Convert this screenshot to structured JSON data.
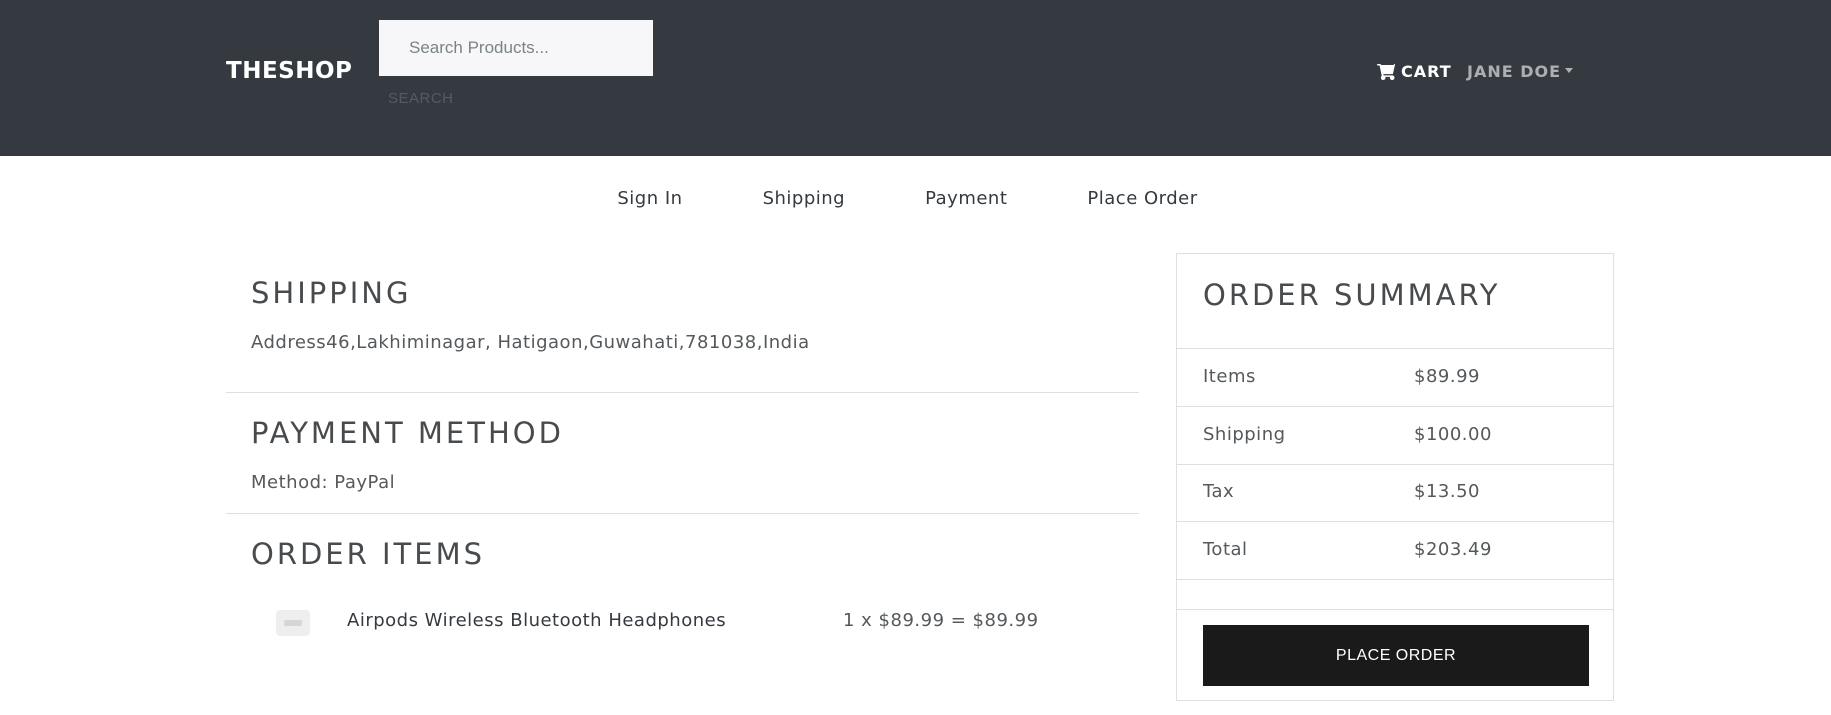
{
  "header": {
    "brand": "THESHOP",
    "search_placeholder": "Search Products...",
    "search_button": "SEARCH",
    "cart_label": "CART",
    "user_label": "JANE DOE",
    "background_color": "#343a40"
  },
  "steps": [
    "Sign In",
    "Shipping",
    "Payment",
    "Place Order"
  ],
  "shipping": {
    "title": "SHIPPING",
    "address": "Address46,Lakhiminagar, Hatigaon,Guwahati,781038,India"
  },
  "payment": {
    "title": "PAYMENT METHOD",
    "method": "Method: PayPal"
  },
  "order_items": {
    "title": "ORDER ITEMS",
    "items": [
      {
        "name": "Airpods Wireless Bluetooth Headphones",
        "price_line": "1 x $89.99 = $89.99"
      }
    ]
  },
  "summary": {
    "title": "ORDER SUMMARY",
    "rows": [
      {
        "label": "Items",
        "value": "$89.99"
      },
      {
        "label": "Shipping",
        "value": "$100.00"
      },
      {
        "label": "Tax",
        "value": "$13.50"
      },
      {
        "label": "Total",
        "value": "$203.49"
      }
    ],
    "button": "PLACE ORDER"
  }
}
